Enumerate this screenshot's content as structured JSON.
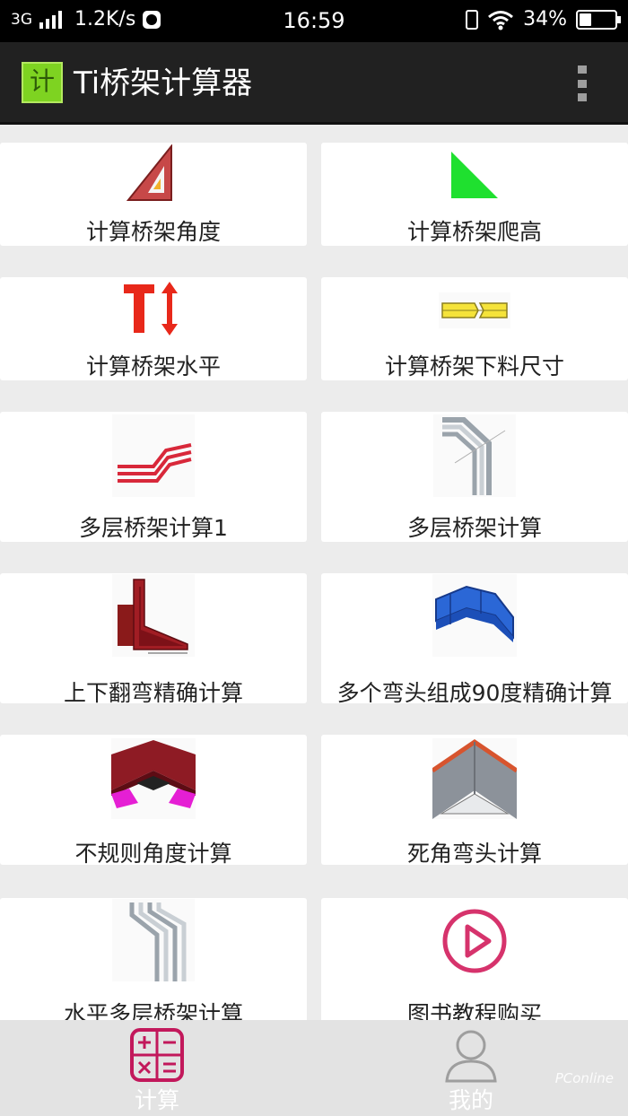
{
  "status_bar": {
    "network": "3G",
    "speed": "1.2K/s",
    "time": "16:59",
    "battery_text": "34%",
    "battery_level": 0.34
  },
  "app_bar": {
    "icon_char": "计",
    "title": "Ti桥架计算器",
    "overflow_icon": "more-vert-icon"
  },
  "grid": {
    "items": [
      {
        "label": "计算桥架角度",
        "icon": "triangle-ruler-icon"
      },
      {
        "label": "计算桥架爬高",
        "icon": "green-triangle-icon"
      },
      {
        "label": "计算桥架水平",
        "icon": "t-arrow-icon"
      },
      {
        "label": "计算桥架下料尺寸",
        "icon": "yellow-cut-tray-icon"
      },
      {
        "label": "多层桥架计算1",
        "icon": "red-multilayer-icon"
      },
      {
        "label": "多层桥架计算",
        "icon": "gray-multilayer-icon"
      },
      {
        "label": "上下翻弯精确计算",
        "icon": "red-vertical-bend-icon"
      },
      {
        "label": "多个弯头组成90度精确计算",
        "icon": "blue-elbow-icon"
      },
      {
        "label": "不规则角度计算",
        "icon": "red-irregular-angle-icon"
      },
      {
        "label": "死角弯头计算",
        "icon": "gray-dead-angle-icon"
      },
      {
        "label": "水平多层桥架计算",
        "icon": "gray-horizontal-multilayer-icon"
      },
      {
        "label": "图书教程购买",
        "icon": "play-circle-icon"
      }
    ]
  },
  "bottom_nav": {
    "items": [
      {
        "label": "计算",
        "icon": "calculator-icon",
        "active": true
      },
      {
        "label": "我的",
        "icon": "person-icon",
        "active": false
      }
    ],
    "watermark": "PConline"
  },
  "colors": {
    "accent": "#c2185b",
    "app_bar": "#212121",
    "status_bar": "#000000",
    "background": "#ececec"
  }
}
